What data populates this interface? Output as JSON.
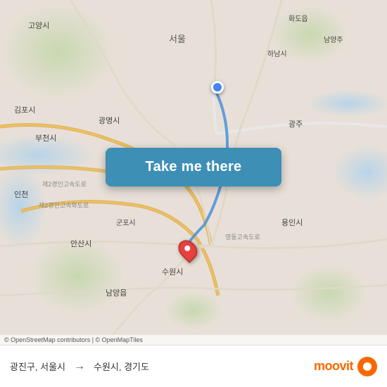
{
  "map": {
    "attribution": "© OpenStreetMap contributors | © OpenMapTiles",
    "origin_marker_color": "#4285f4",
    "dest_marker_color": "#e84040"
  },
  "button": {
    "label": "Take me there"
  },
  "route": {
    "origin": "광진구, 서울시",
    "arrow": "→",
    "destination": "수원시, 경기도"
  },
  "branding": {
    "name": "moovit",
    "icon_label": "moovit-logo"
  }
}
